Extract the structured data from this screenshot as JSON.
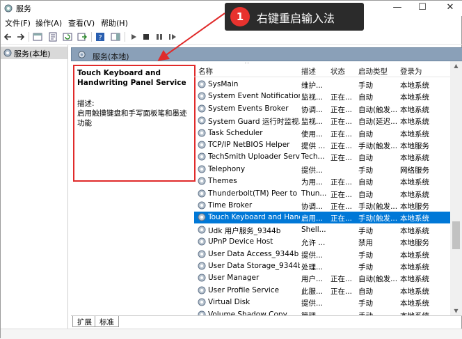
{
  "window": {
    "title": "服务",
    "minimize": "—",
    "maximize": "☐",
    "close": "✕"
  },
  "menu": [
    "文件(F)",
    "操作(A)",
    "查看(V)",
    "帮助(H)"
  ],
  "tree": {
    "item": "服务(本地)"
  },
  "pane_header": "服务(本地)",
  "detail": {
    "service_name": "Touch Keyboard and Handwriting Panel Service",
    "desc_label": "描述:",
    "desc_text": "启用触摸键盘和手写面板笔和墨迹功能"
  },
  "columns": {
    "name": "名称",
    "desc": "描述",
    "status": "状态",
    "startup": "启动类型",
    "logon": "登录为"
  },
  "rows": [
    {
      "name": "SysMain",
      "desc": "维护...",
      "status": "",
      "startup": "手动",
      "logon": "本地系统"
    },
    {
      "name": "System Event Notification ...",
      "desc": "监视...",
      "status": "正在...",
      "startup": "自动",
      "logon": "本地系统"
    },
    {
      "name": "System Events Broker",
      "desc": "协调...",
      "status": "正在...",
      "startup": "自动(触发...",
      "logon": "本地系统"
    },
    {
      "name": "System Guard 运行时监视...",
      "desc": "监视...",
      "status": "正在...",
      "startup": "自动(延迟...",
      "logon": "本地系统"
    },
    {
      "name": "Task Scheduler",
      "desc": "使用...",
      "status": "正在...",
      "startup": "自动",
      "logon": "本地系统"
    },
    {
      "name": "TCP/IP NetBIOS Helper",
      "desc": "提供 ...",
      "status": "正在...",
      "startup": "手动(触发...",
      "logon": "本地服务"
    },
    {
      "name": "TechSmith Uploader Service",
      "desc": "Tech...",
      "status": "正在...",
      "startup": "自动",
      "logon": "本地系统"
    },
    {
      "name": "Telephony",
      "desc": "提供...",
      "status": "",
      "startup": "手动",
      "logon": "网络服务"
    },
    {
      "name": "Themes",
      "desc": "为用...",
      "status": "正在...",
      "startup": "自动",
      "logon": "本地系统"
    },
    {
      "name": "Thunderbolt(TM) Peer to P...",
      "desc": "Thun...",
      "status": "正在...",
      "startup": "自动",
      "logon": "本地系统"
    },
    {
      "name": "Time Broker",
      "desc": "协调...",
      "status": "正在...",
      "startup": "手动(触发...",
      "logon": "本地服务"
    },
    {
      "name": "Touch Keyboard and Hand...",
      "desc": "启用...",
      "status": "正在...",
      "startup": "手动(触发...",
      "logon": "本地系统",
      "selected": true
    },
    {
      "name": "Udk 用户服务_9344b",
      "desc": "Shell...",
      "status": "",
      "startup": "手动",
      "logon": "本地系统"
    },
    {
      "name": "UPnP Device Host",
      "desc": "允许 ...",
      "status": "",
      "startup": "禁用",
      "logon": "本地服务"
    },
    {
      "name": "User Data Access_9344b",
      "desc": "提供...",
      "status": "",
      "startup": "手动",
      "logon": "本地系统"
    },
    {
      "name": "User Data Storage_9344b",
      "desc": "处理...",
      "status": "",
      "startup": "手动",
      "logon": "本地系统"
    },
    {
      "name": "User Manager",
      "desc": "用户...",
      "status": "正在...",
      "startup": "自动(触发...",
      "logon": "本地系统"
    },
    {
      "name": "User Profile Service",
      "desc": "此服...",
      "status": "正在...",
      "startup": "自动",
      "logon": "本地系统"
    },
    {
      "name": "Virtual Disk",
      "desc": "提供...",
      "status": "",
      "startup": "手动",
      "logon": "本地系统"
    },
    {
      "name": "Volume Shadow Copy",
      "desc": "管理...",
      "status": "",
      "startup": "手动",
      "logon": "本地系统"
    }
  ],
  "tabs": [
    "扩展",
    "标准"
  ],
  "callout": {
    "number": "1",
    "text": "右键重启输入法"
  },
  "colors": {
    "selection": "#0078d7",
    "highlight_border": "#e02a2a",
    "pane_header": "#8aa0b8",
    "callout_bg": "#2b2b2b",
    "badge": "#e8322e"
  }
}
